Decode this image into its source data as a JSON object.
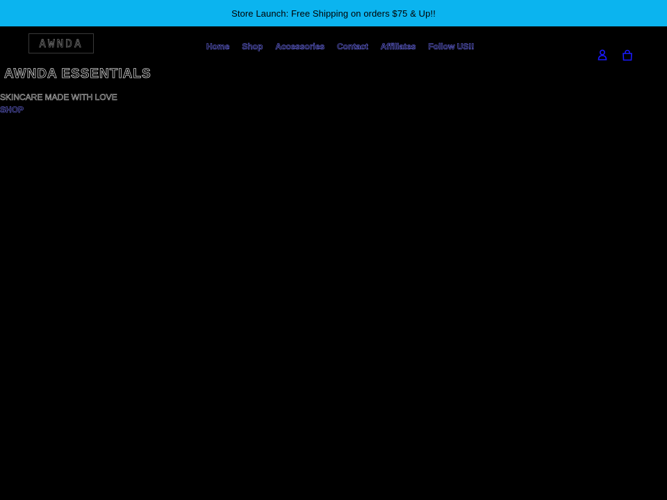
{
  "announcement": {
    "text": "Store Launch: Free Shipping on orders $75 & Up!!",
    "background": "#0bb4ef"
  },
  "header": {
    "logo_text": "AWNDA",
    "nav": [
      {
        "label": "Home"
      },
      {
        "label": "Shop"
      },
      {
        "label": "Accessories"
      },
      {
        "label": "Contact"
      },
      {
        "label": "Affiliates"
      },
      {
        "label": "Follow US!!"
      }
    ],
    "icons": {
      "account": "account-icon",
      "cart": "cart-icon"
    },
    "link_color": "#6e6ef2",
    "icon_color": "#1a1aff"
  },
  "hero": {
    "title": "AWNDA ESSENTIALS",
    "subtitle": "SKINCARE MADE WITH LOVE",
    "cta_label": "SHOP"
  }
}
